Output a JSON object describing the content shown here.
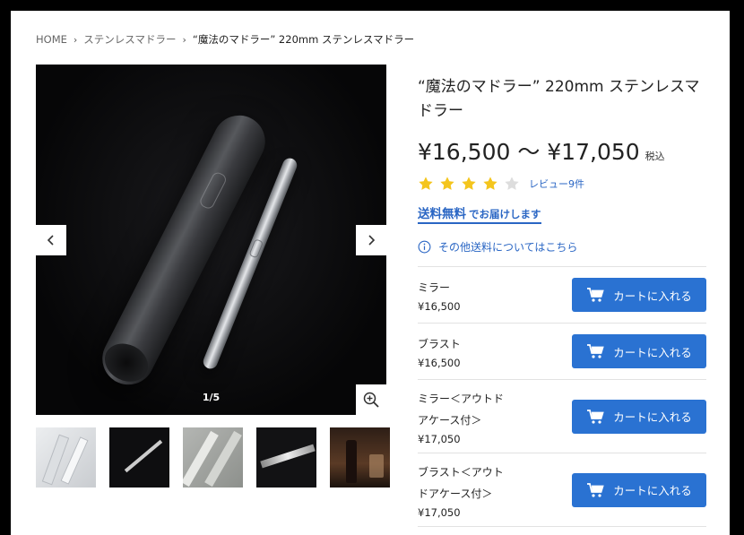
{
  "breadcrumb": {
    "items": [
      "HOME",
      "ステンレスマドラー",
      "“魔法のマドラー” 220mm ステンレスマドラー"
    ],
    "separator": "›"
  },
  "gallery": {
    "counter": "1/5",
    "prev_icon": "chevron-left-icon",
    "next_icon": "chevron-right-icon",
    "zoom_icon": "zoom-in-icon",
    "thumbnails": [
      "thumbnail-1",
      "thumbnail-2",
      "thumbnail-3",
      "thumbnail-4",
      "thumbnail-5"
    ]
  },
  "product": {
    "title": "“魔法のマドラー” 220mm ステンレスマドラー",
    "price_range": "¥16,500 〜 ¥17,050",
    "tax_label": "税込",
    "rating": 4,
    "rating_max": 5,
    "review_link": "レビュー9件",
    "shipping_strong": "送料無料",
    "shipping_sub": "でお届けします",
    "other_shipping": "その他送料についてはこちら"
  },
  "variants": [
    {
      "name_lines": [
        "ミラー"
      ],
      "price": "¥16,500",
      "button": "カートに入れる"
    },
    {
      "name_lines": [
        "ブラスト"
      ],
      "price": "¥16,500",
      "button": "カートに入れる"
    },
    {
      "name_lines": [
        "ミラー＜アウトド",
        "アケース付＞"
      ],
      "price": "¥17,050",
      "button": "カートに入れる"
    },
    {
      "name_lines": [
        "ブラスト＜アウト",
        "ドアケース付＞"
      ],
      "price": "¥17,050",
      "button": "カートに入れる"
    }
  ],
  "colors": {
    "accent": "#2a72d2",
    "link": "#2a66c4",
    "star_filled": "#f4c51d",
    "star_empty": "#dddddd"
  }
}
